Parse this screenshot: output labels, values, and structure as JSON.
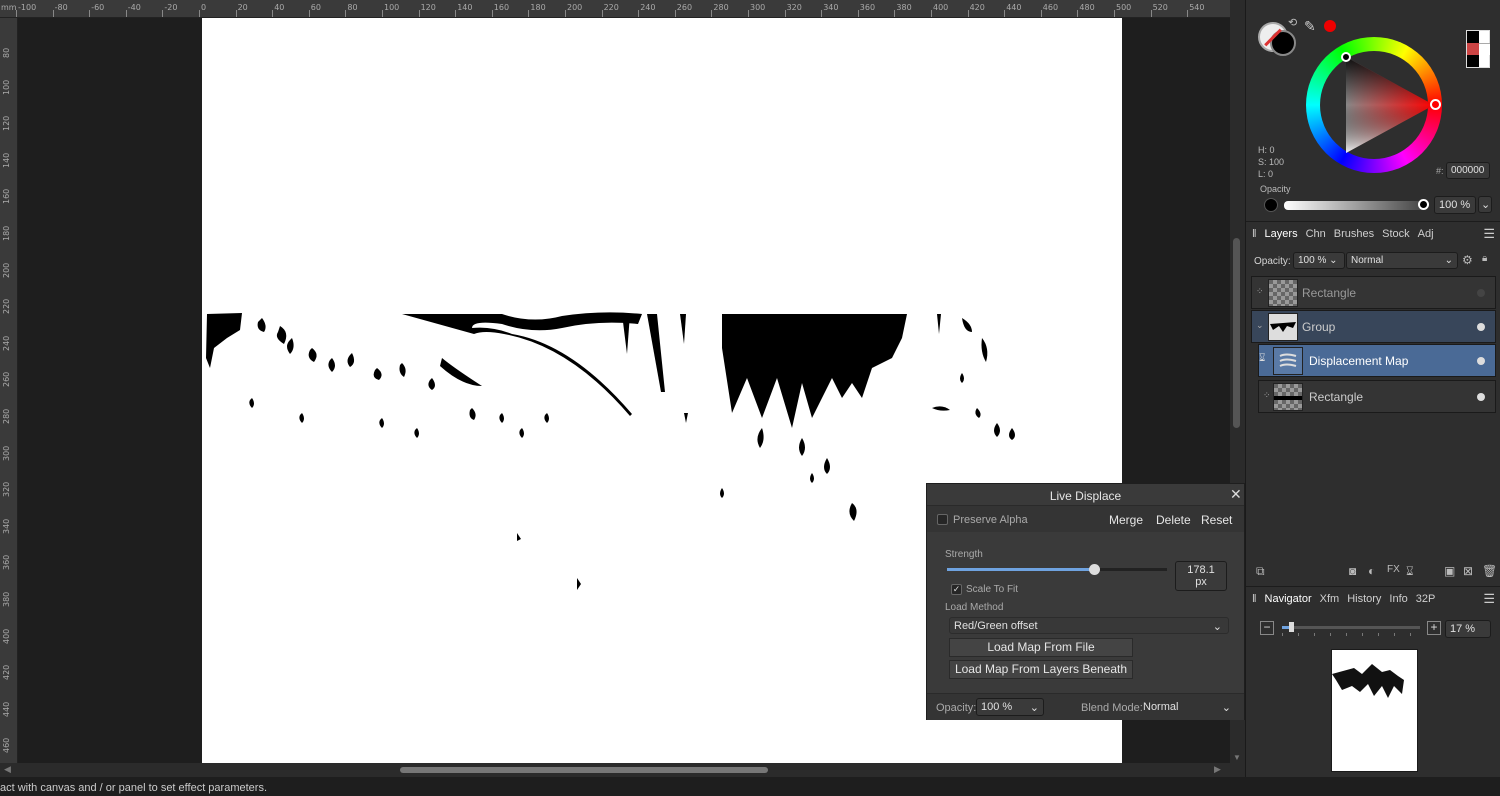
{
  "rulers": {
    "top": [
      "-100",
      "-80",
      "-60",
      "-40",
      "-20",
      "0",
      "20",
      "40",
      "60",
      "80",
      "100",
      "120",
      "140",
      "160",
      "180",
      "200",
      "220",
      "240",
      "260",
      "280",
      "300",
      "320",
      "340",
      "360",
      "380",
      "400",
      "420",
      "440",
      "460",
      "480",
      "500",
      "520",
      "540"
    ],
    "top_unit": "mm",
    "left": [
      "80",
      "100",
      "120",
      "140",
      "160",
      "180",
      "200",
      "220",
      "240",
      "260",
      "280",
      "300",
      "320",
      "340",
      "360",
      "380",
      "400",
      "420",
      "440",
      "460"
    ]
  },
  "status_text": "act with canvas and / or panel to set effect parameters.",
  "colour": {
    "h": "H: 0",
    "s": "S: 100",
    "l": "L: 0",
    "hex_label": "#:",
    "hex": "000000",
    "opacity_label": "Opacity",
    "opacity_value": "100 %"
  },
  "layers_panel": {
    "tabs": [
      "Layers",
      "Chn",
      "Brushes",
      "Stock",
      "Adj"
    ],
    "opacity_label": "Opacity:",
    "opacity_value": "100 %",
    "blend": "Normal",
    "layers": [
      {
        "name": "Rectangle"
      },
      {
        "name": "Group"
      },
      {
        "name": "Displacement Map"
      },
      {
        "name": "Rectangle"
      }
    ]
  },
  "navigator": {
    "tabs": [
      "Navigator",
      "Xfm",
      "History",
      "Info",
      "32P"
    ],
    "zoom": "17 %",
    "zoom_fraction": 0.05
  },
  "dialog": {
    "title": "Live Displace",
    "preserve_alpha": "Preserve Alpha",
    "merge": "Merge",
    "delete": "Delete",
    "reset": "Reset",
    "strength_label": "Strength",
    "strength_value": "178.1 px",
    "strength_fraction": 0.67,
    "scale_to_fit": "Scale To Fit",
    "load_method_label": "Load Method",
    "load_method_value": "Red/Green offset",
    "load_from_file": "Load Map From File",
    "load_from_layers": "Load Map From Layers Beneath",
    "opacity_label": "Opacity:",
    "opacity_value": "100 %",
    "blend_label": "Blend Mode:",
    "blend_value": "Normal"
  }
}
